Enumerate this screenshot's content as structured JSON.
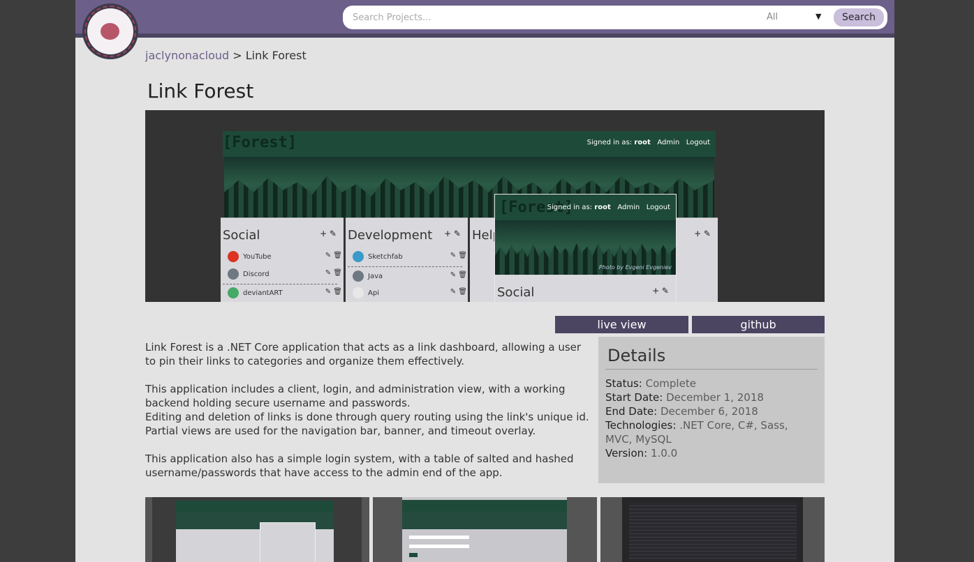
{
  "search": {
    "placeholder": "Search Projects...",
    "category": "All",
    "button": "Search"
  },
  "breadcrumb": {
    "user": "jaclynonacloud",
    "separator": ">",
    "current": "Link Forest"
  },
  "project": {
    "title": "Link Forest"
  },
  "hero": {
    "app_logo": "[Forest]",
    "signed_in_label": "Signed in as:",
    "signed_in_user": "root",
    "admin_link": "Admin",
    "logout_link": "Logout",
    "photo_credit": "Photo by Evgeni Evgeniev",
    "columns": [
      {
        "title": "Social",
        "links": [
          "YouTube",
          "Discord",
          "deviantART"
        ]
      },
      {
        "title": "Development",
        "links": [
          "Sketchfab",
          "Java",
          "Api"
        ]
      },
      {
        "title": "Help",
        "links": []
      }
    ],
    "overlay_column_title": "Social"
  },
  "actions": {
    "live_view": "live view",
    "github": "github"
  },
  "description": [
    "Link Forest is a .NET Core application that acts as a link dashboard, allowing a user to pin their links to categories and organize them effectively.",
    "This application includes a client, login, and administration view, with a working backend holding secure username and passwords.",
    "Editing and deletion of links is done through query routing using the link's unique id.",
    "Partial views are used for the navigation bar, banner, and timeout overlay.",
    "This application also has a simple login system, with a table of salted and hashed username/passwords that have access to the admin end of the app."
  ],
  "details": {
    "title": "Details",
    "status_label": "Status:",
    "status": "Complete",
    "start_label": "Start Date:",
    "start": "December 1, 2018",
    "end_label": "End Date:",
    "end": "December 6, 2018",
    "tech_label": "Technologies:",
    "tech": ".NET Core, C#, Sass, MVC, MySQL",
    "version_label": "Version:",
    "version": "1.0.0"
  },
  "colors": {
    "nav": "#6c5f8a",
    "nav_dark": "#4b4562",
    "forest": "#1e4a3a",
    "accent": "#c9bedc"
  }
}
